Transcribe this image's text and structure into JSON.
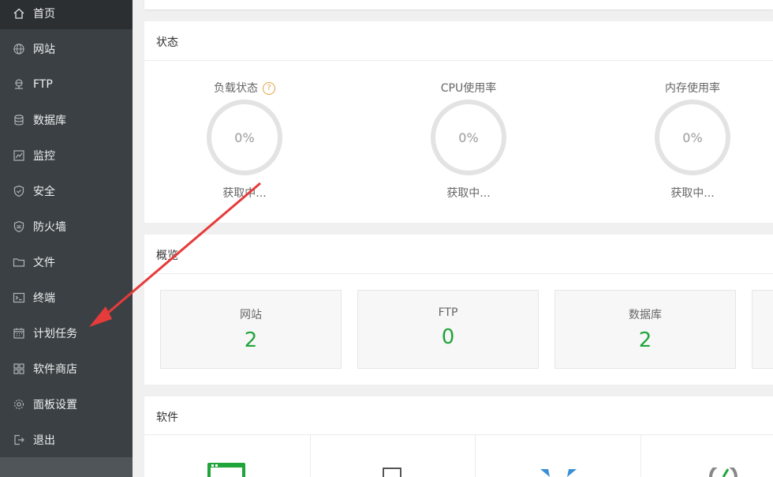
{
  "sidebar": {
    "items": [
      {
        "label": "首页",
        "icon": "home-icon"
      },
      {
        "label": "网站",
        "icon": "globe-icon"
      },
      {
        "label": "FTP",
        "icon": "ftp-server-icon"
      },
      {
        "label": "数据库",
        "icon": "database-icon"
      },
      {
        "label": "监控",
        "icon": "monitor-icon"
      },
      {
        "label": "安全",
        "icon": "shield-check-icon"
      },
      {
        "label": "防火墙",
        "icon": "firewall-icon"
      },
      {
        "label": "文件",
        "icon": "folder-icon"
      },
      {
        "label": "终端",
        "icon": "terminal-icon"
      },
      {
        "label": "计划任务",
        "icon": "calendar-icon"
      },
      {
        "label": "软件商店",
        "icon": "apps-grid-icon"
      },
      {
        "label": "面板设置",
        "icon": "gear-icon"
      },
      {
        "label": "退出",
        "icon": "logout-icon"
      }
    ],
    "active_index": 0
  },
  "status": {
    "title": "状态",
    "gauges": [
      {
        "title": "负载状态",
        "value": "0%",
        "sub": "获取中..."
      },
      {
        "title": "CPU使用率",
        "value": "0%",
        "sub": "获取中..."
      },
      {
        "title": "内存使用率",
        "value": "0%",
        "sub": "获取中..."
      }
    ],
    "help_icon": "?"
  },
  "overview": {
    "title": "概览",
    "cards": [
      {
        "label": "网站",
        "value": "2"
      },
      {
        "label": "FTP",
        "value": "0"
      },
      {
        "label": "数据库",
        "value": "2"
      }
    ]
  },
  "software": {
    "title": "软件"
  },
  "colors": {
    "sidebar_bg": "#3b4044",
    "sidebar_active": "#2b2f32",
    "accent_green": "#20a53a",
    "annotation_arrow": "#e63b3b"
  }
}
